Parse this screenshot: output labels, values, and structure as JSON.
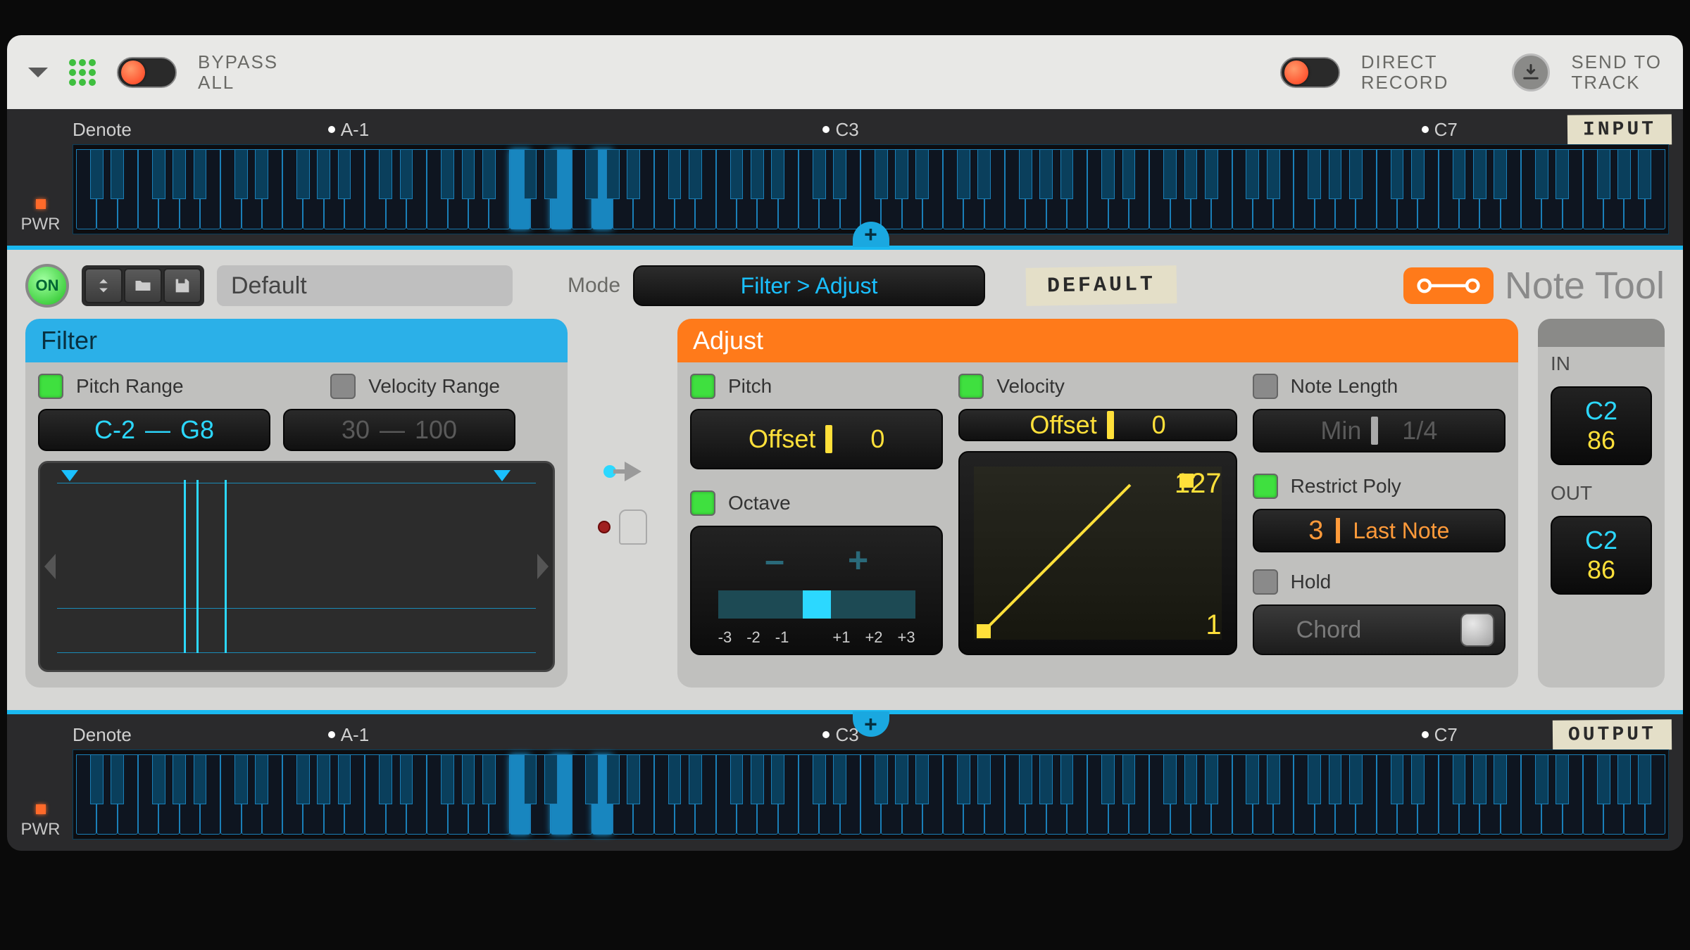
{
  "header": {
    "bypass_line1": "BYPASS",
    "bypass_line2": "ALL",
    "direct_line1": "DIRECT",
    "direct_line2": "RECORD",
    "send_line1": "SEND TO",
    "send_line2": "TRACK"
  },
  "input_strip": {
    "title": "Denote",
    "marker1": "A-1",
    "marker2": "C3",
    "marker3": "C7",
    "tag": "INPUT",
    "pwr": "PWR"
  },
  "output_strip": {
    "title": "Denote",
    "marker1": "A-1",
    "marker2": "C3",
    "marker3": "C7",
    "tag": "OUTPUT",
    "pwr": "PWR"
  },
  "toolbar": {
    "on_label": "ON",
    "preset": "Default",
    "mode_label": "Mode",
    "mode_value": "Filter > Adjust",
    "default_tag": "DEFAULT",
    "tool_title": "Note Tool"
  },
  "filter": {
    "title": "Filter",
    "pitch_range_label": "Pitch Range",
    "velocity_range_label": "Velocity Range",
    "pitch_low": "C-2",
    "pitch_high": "G8",
    "vel_low": "30",
    "vel_high": "100"
  },
  "adjust": {
    "title": "Adjust",
    "pitch_label": "Pitch",
    "velocity_label": "Velocity",
    "note_length_label": "Note Length",
    "offset_label": "Offset",
    "pitch_offset": "0",
    "vel_offset_label": "Offset",
    "vel_offset": "0",
    "nl_min_label": "Min",
    "nl_min_val": "1/4",
    "octave_label": "Octave",
    "octave_labels": [
      "-3",
      "-2",
      "-1",
      "+1",
      "+2",
      "+3"
    ],
    "vel_max": "127",
    "vel_min": "1",
    "restrict_label": "Restrict Poly",
    "poly_count": "3",
    "poly_mode": "Last Note",
    "hold_label": "Hold",
    "chord_label": "Chord"
  },
  "io": {
    "in_label": "IN",
    "out_label": "OUT",
    "in_note": "C2",
    "in_vel": "86",
    "out_note": "C2",
    "out_vel": "86"
  }
}
